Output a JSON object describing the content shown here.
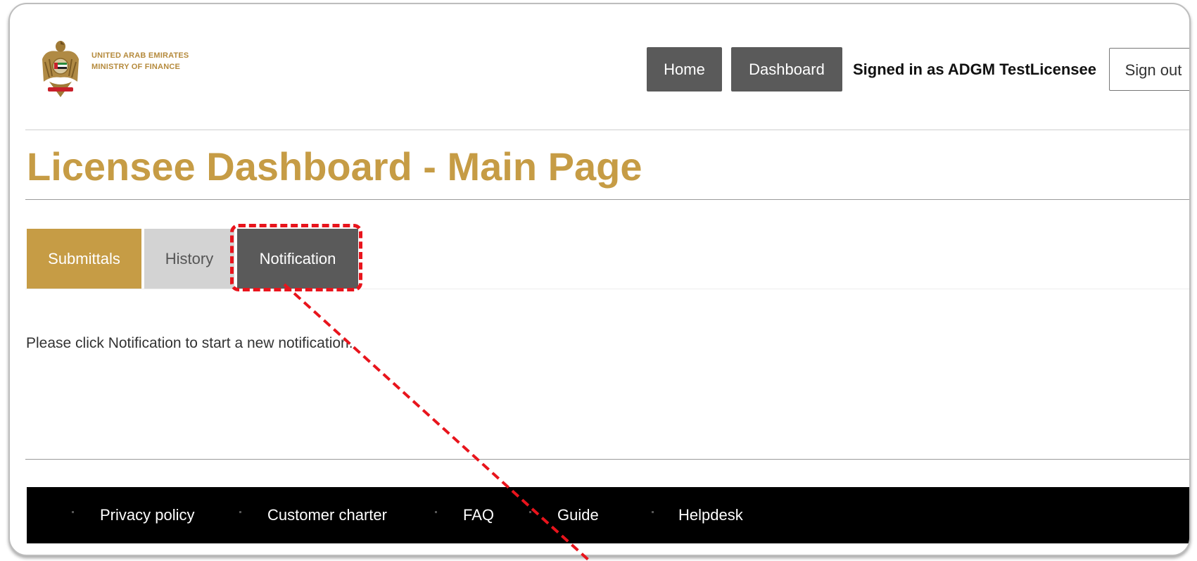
{
  "header": {
    "logo_line1": "UNITED ARAB EMIRATES",
    "logo_line2": "MINISTRY OF FINANCE",
    "nav": {
      "home_label": "Home",
      "dashboard_label": "Dashboard"
    },
    "signed_in_text": "Signed in as ADGM TestLicensee",
    "sign_out_label": "Sign out"
  },
  "page_title": "Licensee Dashboard - Main Page",
  "tabs": [
    {
      "label": "Submittals",
      "state": "default"
    },
    {
      "label": "History",
      "state": "inactive"
    },
    {
      "label": "Notification",
      "state": "active"
    }
  ],
  "instruction_text": "Please click Notification to start a new notification.",
  "footer": {
    "links": [
      "Privacy policy",
      "Customer charter",
      "FAQ",
      "Guide",
      "Helpdesk"
    ]
  },
  "annotation": {
    "highlight_color": "#e8141c",
    "target": "Notification"
  },
  "colors": {
    "gold": "#c69c45",
    "dark_gray": "#5a5a5a",
    "light_gray": "#d3d3d3",
    "footer_bg": "#000000"
  },
  "icons": {
    "logo": "uae-falcon-emblem-icon"
  }
}
